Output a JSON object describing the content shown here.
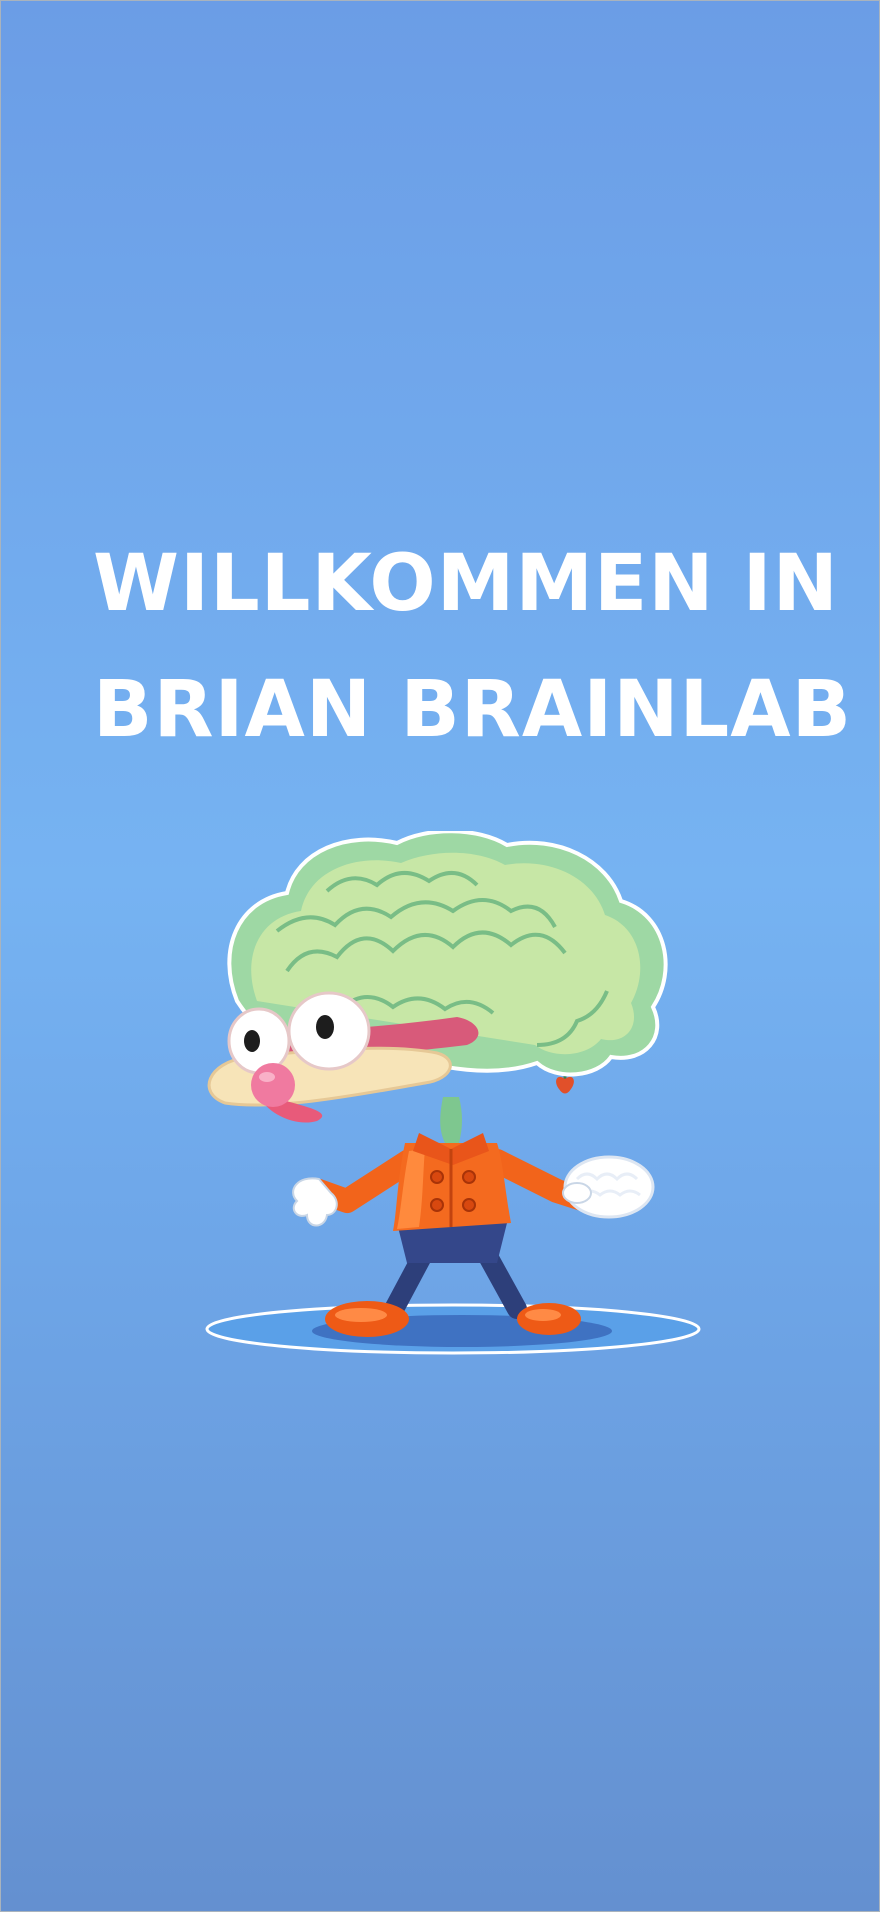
{
  "welcome": {
    "line1": "Willkommen in",
    "line2": "Brian Brainlab"
  },
  "mascot": {
    "icon": "brain-character-mascot-icon"
  },
  "colors": {
    "background_top": "#6b9de6",
    "background_mid": "#76b3f2",
    "background_bottom": "#6490d0",
    "title": "#ffffff"
  }
}
